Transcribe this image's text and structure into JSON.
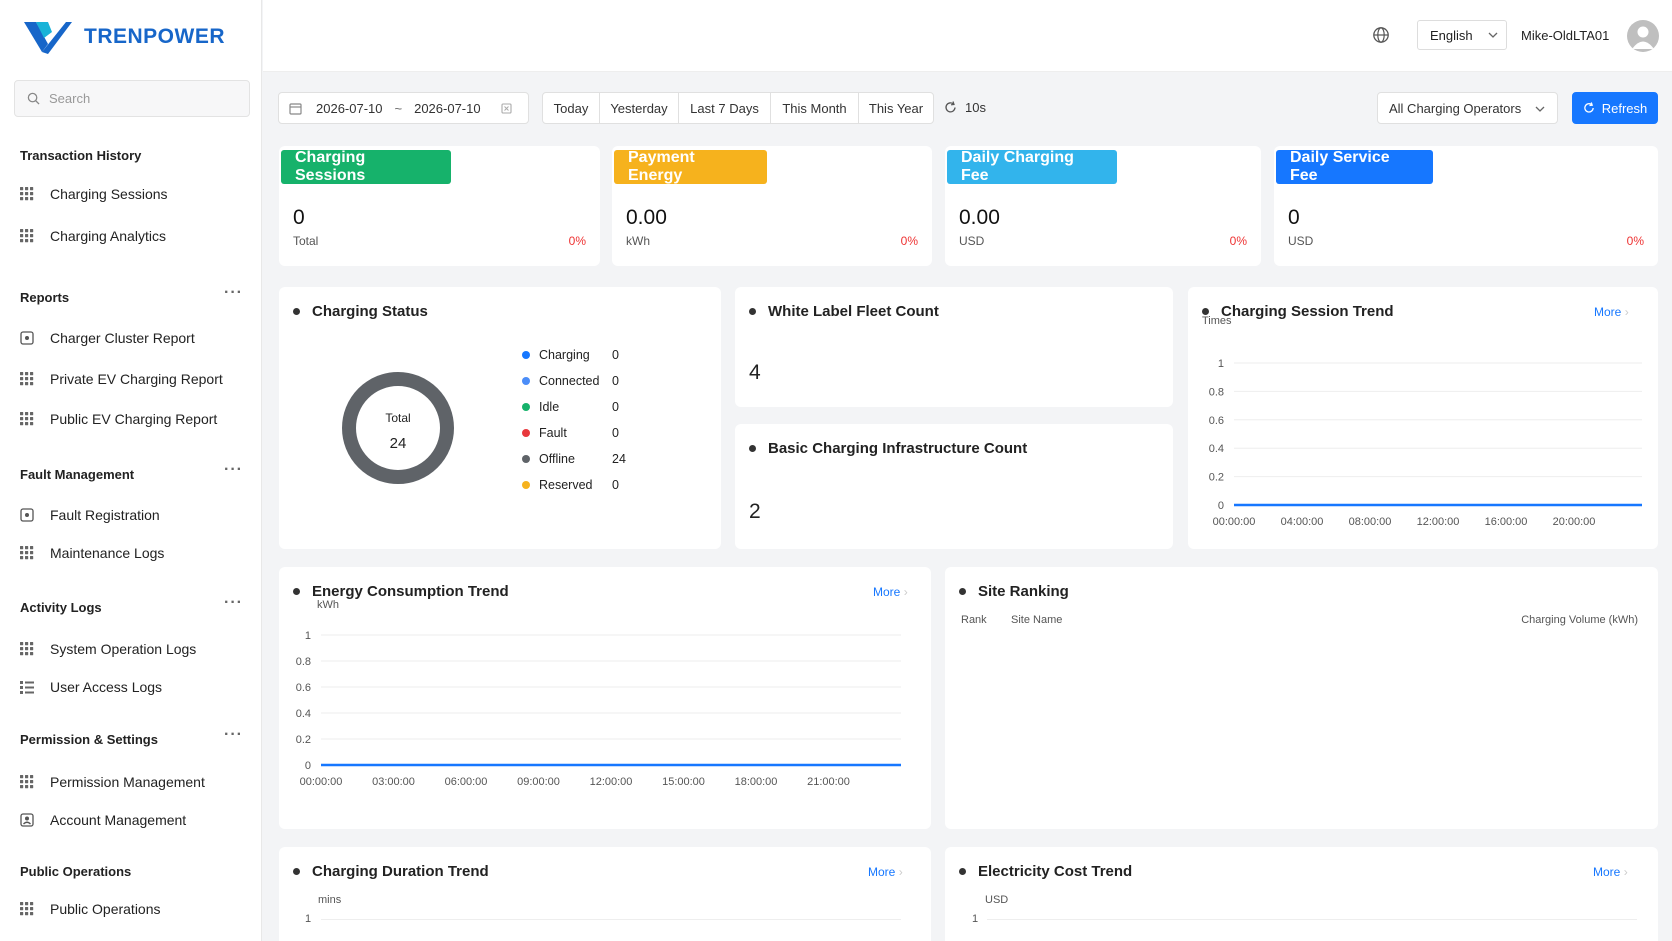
{
  "brand": {
    "name": "TRENPOWER",
    "primary": "#1766c9",
    "accent": "#19b3d8"
  },
  "search": {
    "placeholder": "Search"
  },
  "sidebar": {
    "sections": [
      {
        "title": "Transaction History",
        "items": [
          "Charging Sessions",
          "Charging Analytics"
        ]
      },
      {
        "title": "Reports",
        "items": [
          "Charger Cluster Report",
          "Private EV Charging Report",
          "Public EV Charging Report"
        ]
      },
      {
        "title": "Fault Management",
        "items": [
          "Fault Registration",
          "Maintenance Logs"
        ]
      },
      {
        "title": "Activity Logs",
        "items": [
          "System Operation Logs",
          "User Access Logs"
        ]
      },
      {
        "title": "Permission & Settings",
        "items": [
          "Permission Management",
          "Account Management"
        ]
      },
      {
        "title": "Public Operations",
        "items": [
          "Public Operations"
        ]
      }
    ],
    "more_label": "···"
  },
  "header": {
    "language": "English",
    "user": "Mike-OldLTA01"
  },
  "filters": {
    "start_date": "2026-07-10",
    "separator": "~",
    "end_date": "2026-07-10",
    "ranges": [
      "Today",
      "Yesterday",
      "Last 7 Days",
      "This Month",
      "This Year"
    ],
    "auto_refresh": "10s",
    "operator_select": "All Charging Operators",
    "refresh_label": "Refresh"
  },
  "kpis": [
    {
      "title": "Charging Sessions",
      "value": "0",
      "unit": "Total",
      "change": "0%",
      "color": "#16b26b"
    },
    {
      "title": "Payment Energy",
      "value": "0.00",
      "unit": "kWh",
      "change": "0%",
      "color": "#f6b21d"
    },
    {
      "title": "Daily Charging Fee",
      "value": "0.00",
      "unit": "USD",
      "change": "0%",
      "color": "#32b4ec"
    },
    {
      "title": "Daily Service Fee",
      "value": "0",
      "unit": "USD",
      "change": "0%",
      "color": "#1677ff"
    }
  ],
  "charging_status": {
    "title": "Charging Status",
    "total_label": "Total",
    "total": "24",
    "legend": [
      {
        "label": "Charging",
        "value": "0",
        "color": "#1677ff"
      },
      {
        "label": "Connected",
        "value": "0",
        "color": "#4b8df8"
      },
      {
        "label": "Idle",
        "value": "0",
        "color": "#16b26b"
      },
      {
        "label": "Fault",
        "value": "0",
        "color": "#e8383d"
      },
      {
        "label": "Offline",
        "value": "24",
        "color": "#5f6368"
      },
      {
        "label": "Reserved",
        "value": "0",
        "color": "#f6b21d"
      }
    ]
  },
  "fleet": {
    "title": "White Label Fleet Count",
    "value": "4"
  },
  "infra": {
    "title": "Basic Charging Infrastructure Count",
    "value": "2"
  },
  "more_label": "More",
  "site_ranking": {
    "title": "Site Ranking",
    "columns": [
      "Rank",
      "Site Name",
      "Charging Volume (kWh)"
    ]
  },
  "chart_data": [
    {
      "type": "line",
      "title": "Charging Session Trend",
      "ylabel": "Times",
      "x": [
        "00:00:00",
        "04:00:00",
        "08:00:00",
        "12:00:00",
        "16:00:00",
        "20:00:00"
      ],
      "yticks": [
        "1",
        "0.8",
        "0.6",
        "0.4",
        "0.2",
        "0"
      ],
      "values": [
        0,
        0,
        0,
        0,
        0,
        0
      ],
      "ylim": [
        0,
        1
      ],
      "color": "#1677ff"
    },
    {
      "type": "line",
      "title": "Energy Consumption Trend",
      "ylabel": "kWh",
      "x": [
        "00:00:00",
        "03:00:00",
        "06:00:00",
        "09:00:00",
        "12:00:00",
        "15:00:00",
        "18:00:00",
        "21:00:00"
      ],
      "yticks": [
        "1",
        "0.8",
        "0.6",
        "0.4",
        "0.2",
        "0"
      ],
      "values": [
        0,
        0,
        0,
        0,
        0,
        0,
        0,
        0
      ],
      "ylim": [
        0,
        1
      ],
      "color": "#1677ff"
    },
    {
      "type": "line",
      "title": "Charging Duration Trend",
      "ylabel": "mins",
      "yticks": [
        "1"
      ]
    },
    {
      "type": "line",
      "title": "Electricity Cost Trend",
      "ylabel": "USD",
      "yticks": [
        "1"
      ]
    }
  ]
}
